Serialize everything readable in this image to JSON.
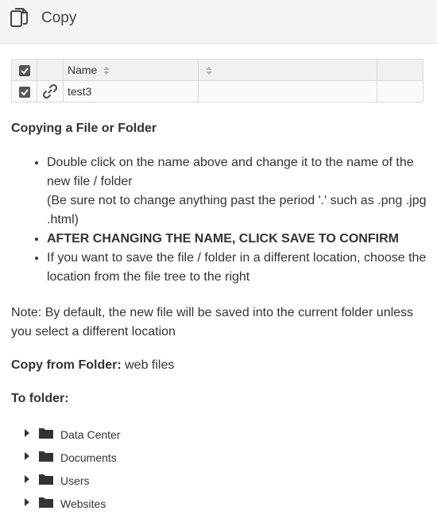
{
  "header": {
    "title": "Copy",
    "icon": "copy-icon"
  },
  "table": {
    "columns": {
      "name": "Name"
    },
    "rows": [
      {
        "name": "test3",
        "checked": true
      }
    ]
  },
  "heading": "Copying a File or Folder",
  "instructions": {
    "item1_line1": "Double click on the name above and change it to the name of the new file / folder",
    "item1_line2": "(Be sure not to change anything past the period '.' such as .png .jpg .html)",
    "item2": "AFTER CHANGING THE NAME, CLICK SAVE TO CONFIRM",
    "item3": "If you want to save the file / folder in a different location, choose the location from the file tree to the right"
  },
  "note": "Note: By default, the new file will be saved into the current folder unless you select a different location",
  "copy_from": {
    "label": "Copy from Folder:",
    "value": "web files"
  },
  "to_folder": {
    "label": "To folder:"
  },
  "tree": [
    {
      "label": "Data Center"
    },
    {
      "label": "Documents"
    },
    {
      "label": "Users"
    },
    {
      "label": "Websites"
    }
  ],
  "colors": {
    "checkbox": "#555555",
    "text": "#333333",
    "header_bg": "#f5f5f5"
  }
}
